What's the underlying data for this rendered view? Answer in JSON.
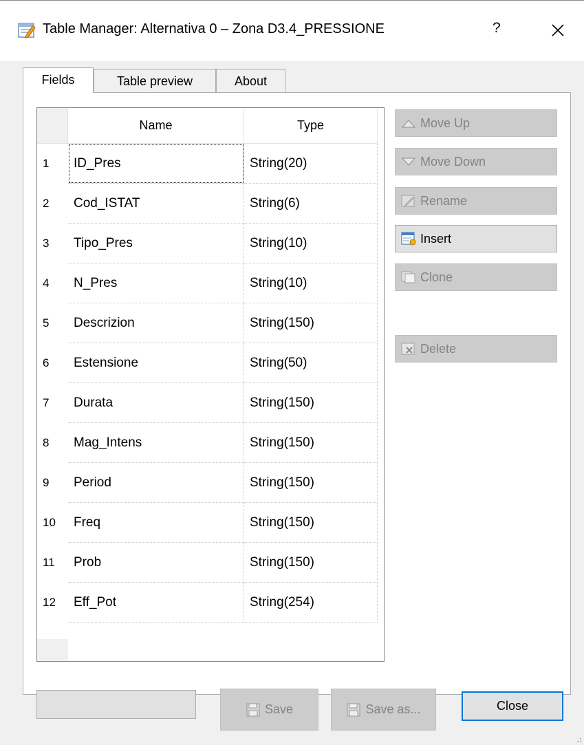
{
  "window": {
    "title": "Table Manager: Alternativa 0 – Zona D3.4_PRESSIONE",
    "help_label": "?",
    "close_label": "✕"
  },
  "tabs": [
    {
      "label": "Fields",
      "active": true
    },
    {
      "label": "Table preview",
      "active": false
    },
    {
      "label": "About",
      "active": false
    }
  ],
  "table": {
    "columns": [
      "Name",
      "Type"
    ],
    "rows": [
      {
        "num": "1",
        "name": "ID_Pres",
        "type": "String(20)"
      },
      {
        "num": "2",
        "name": "Cod_ISTAT",
        "type": "String(6)"
      },
      {
        "num": "3",
        "name": "Tipo_Pres",
        "type": "String(10)"
      },
      {
        "num": "4",
        "name": "N_Pres",
        "type": "String(10)"
      },
      {
        "num": "5",
        "name": "Descrizion",
        "type": "String(150)"
      },
      {
        "num": "6",
        "name": "Estensione",
        "type": "String(50)"
      },
      {
        "num": "7",
        "name": "Durata",
        "type": "String(150)"
      },
      {
        "num": "8",
        "name": "Mag_Intens",
        "type": "String(150)"
      },
      {
        "num": "9",
        "name": "Period",
        "type": "String(150)"
      },
      {
        "num": "10",
        "name": "Freq",
        "type": "String(150)"
      },
      {
        "num": "11",
        "name": "Prob",
        "type": "String(150)"
      },
      {
        "num": "12",
        "name": "Eff_Pot",
        "type": "String(254)"
      }
    ]
  },
  "side_buttons": {
    "move_up": "Move Up",
    "move_down": "Move Down",
    "rename": "Rename",
    "insert": "Insert",
    "clone": "Clone",
    "delete": "Delete"
  },
  "footer": {
    "status_value": "",
    "save": "Save",
    "save_as": "Save as...",
    "close": "Close"
  },
  "icons": {
    "app": "table-manager-icon",
    "move_up": "triangle-up-icon",
    "move_down": "triangle-down-icon",
    "rename": "rename-icon",
    "insert": "insert-row-icon",
    "clone": "clone-icon",
    "delete": "delete-icon",
    "save": "floppy-disk-icon",
    "save_as": "floppy-disk-as-icon"
  },
  "colors": {
    "focus_border": "#0078d7",
    "disabled_button": "#cccccc",
    "disabled_text": "#838383"
  }
}
